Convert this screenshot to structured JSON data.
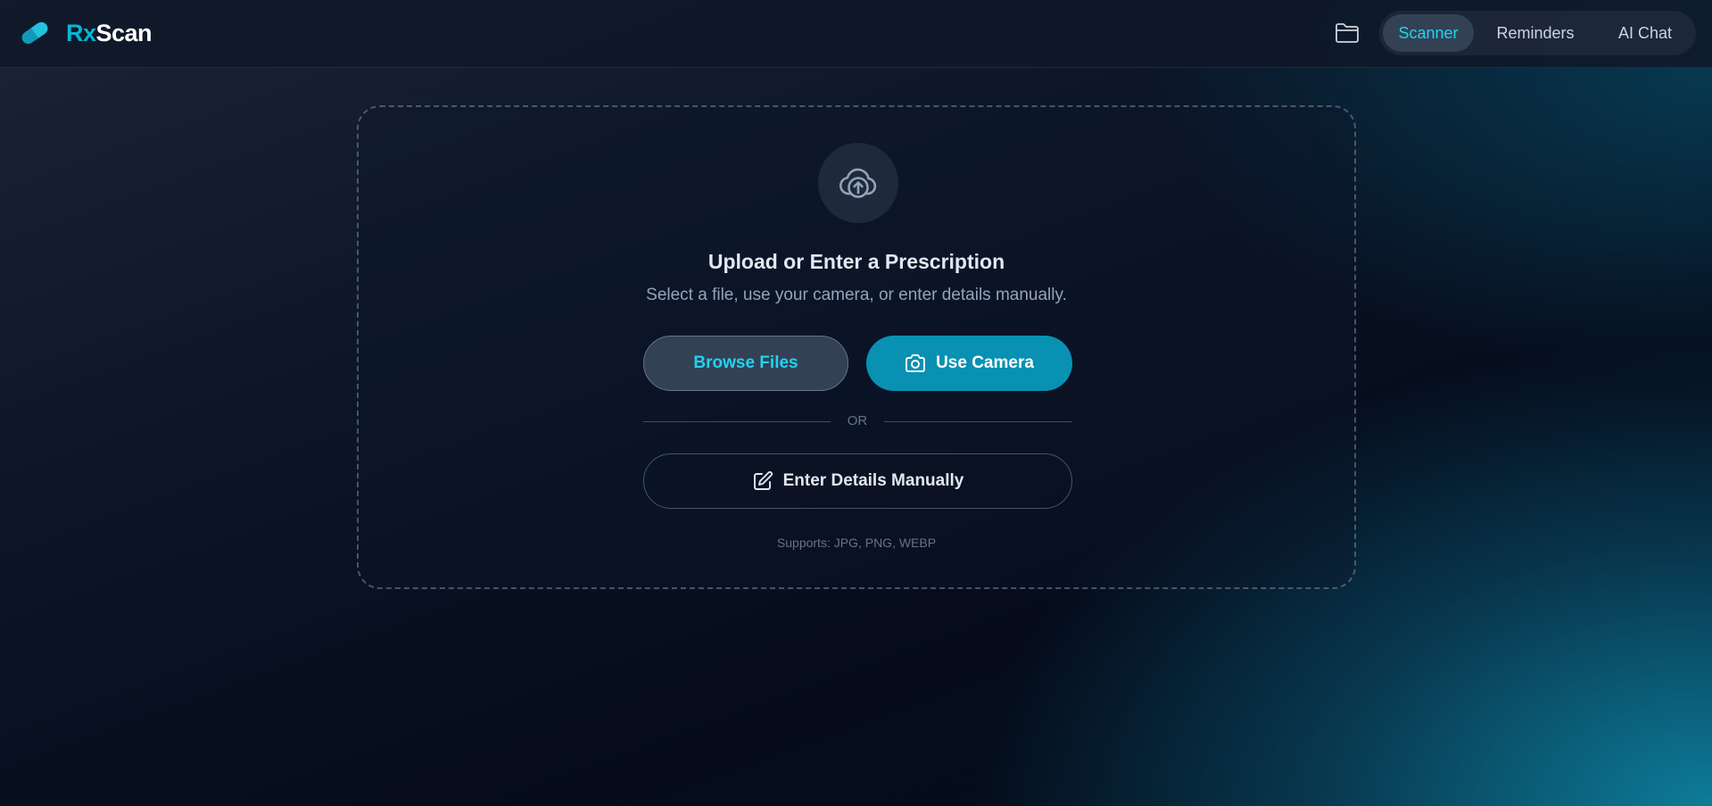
{
  "brand": {
    "prefix": "Rx",
    "suffix": "Scan",
    "icon": "pill-icon"
  },
  "header": {
    "folder_icon": "folder-icon",
    "nav": [
      {
        "label": "Scanner",
        "active": true
      },
      {
        "label": "Reminders",
        "active": false
      },
      {
        "label": "AI Chat",
        "active": false
      }
    ]
  },
  "upload": {
    "icon": "cloud-upload-icon",
    "title": "Upload or Enter a Prescription",
    "subtitle": "Select a file, use your camera, or enter details manually.",
    "browse_label": "Browse Files",
    "camera_label": "Use Camera",
    "camera_icon": "camera-icon",
    "divider_label": "OR",
    "manual_label": "Enter Details Manually",
    "manual_icon": "edit-icon",
    "supports": "Supports: JPG, PNG, WEBP"
  },
  "colors": {
    "accent": "#06b6d4",
    "accent_button": "#0891b2",
    "card_bg": "#1e293b",
    "active_nav_bg": "#334155"
  }
}
